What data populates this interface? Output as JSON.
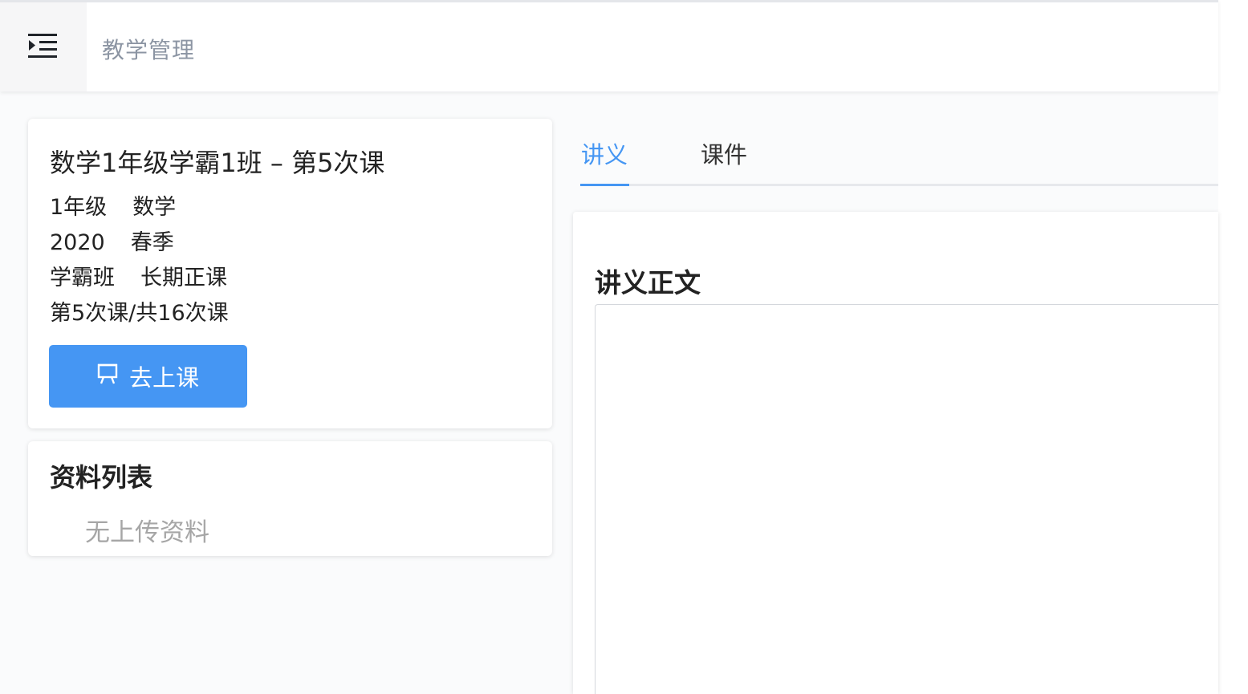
{
  "header": {
    "menu_icon": "indent-menu-icon",
    "title": "教学管理"
  },
  "course": {
    "title": "数学1年级学霸1班 – 第5次课",
    "grade": "1年级",
    "subject": "数学",
    "year": "2020",
    "season": "春季",
    "class_type": "学霸班",
    "course_type": "长期正课",
    "progress": "第5次课/共16次课",
    "go_class_icon": "presentation-icon",
    "go_class_label": "去上课"
  },
  "resources": {
    "title": "资料列表",
    "empty_text": "无上传资料"
  },
  "tabs": [
    {
      "label": "讲义",
      "active": true
    },
    {
      "label": "课件",
      "active": false
    }
  ],
  "notes": {
    "title": "讲义正文",
    "content": ""
  },
  "colors": {
    "accent": "#4596f3",
    "header_text": "#8c95a3",
    "muted_text": "#a6a6a6"
  }
}
